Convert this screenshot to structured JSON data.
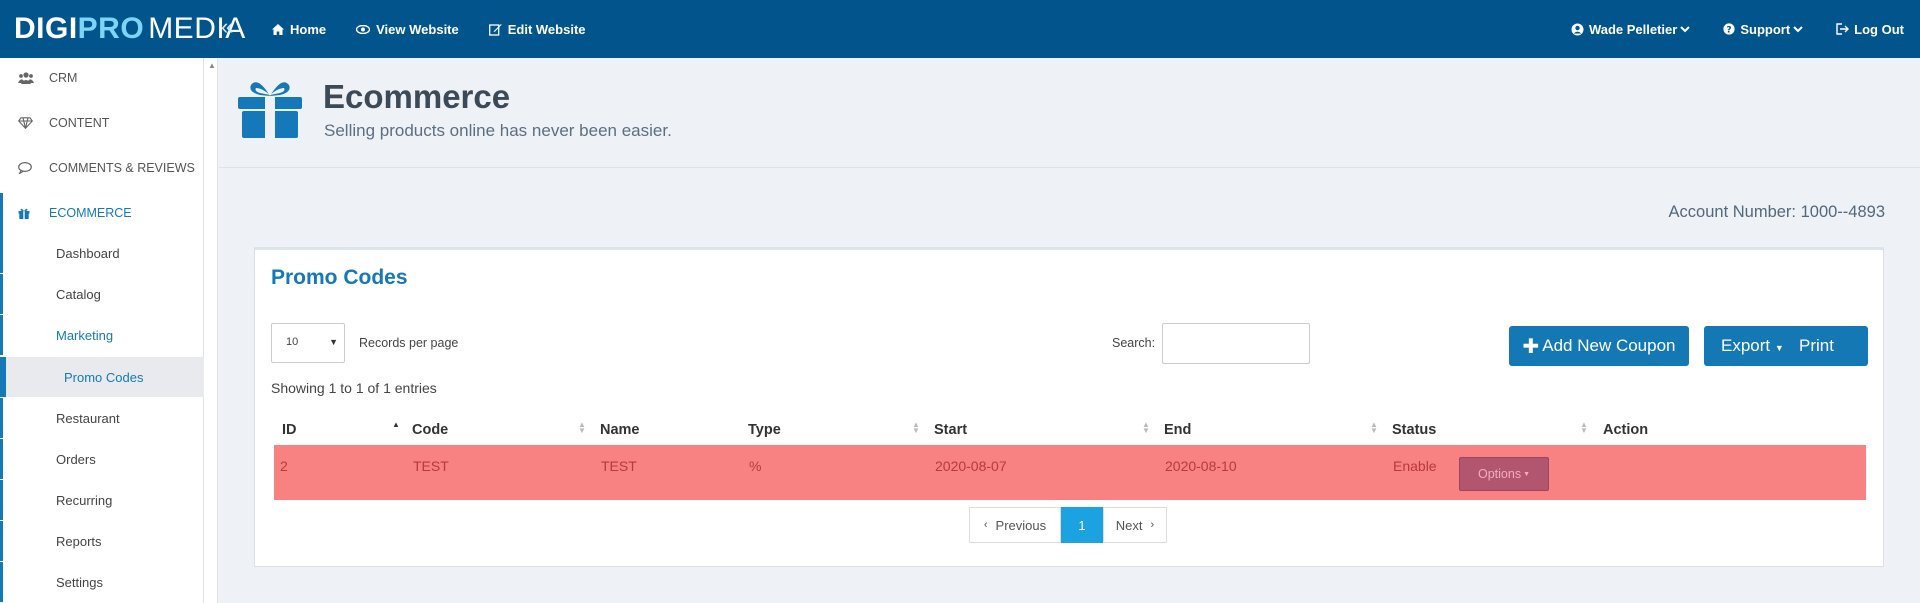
{
  "brand": {
    "part1": "DIGI",
    "part2": "PRO",
    "part3": "MEDIA"
  },
  "topnav": {
    "home": "Home",
    "view_website": "View Website",
    "edit_website": "Edit Website"
  },
  "user": {
    "name": "Wade Pelletier",
    "support": "Support",
    "logout": "Log Out"
  },
  "sidebar": {
    "items": [
      {
        "label": "CRM",
        "icon": "users-icon"
      },
      {
        "label": "CONTENT",
        "icon": "diamond-icon"
      },
      {
        "label": "COMMENTS & REVIEWS",
        "icon": "comment-icon"
      },
      {
        "label": "ECOMMERCE",
        "icon": "gift-icon"
      }
    ],
    "sub": [
      "Dashboard",
      "Catalog",
      "Marketing",
      "Promo Codes",
      "Restaurant",
      "Orders",
      "Recurring",
      "Reports",
      "Settings"
    ]
  },
  "header": {
    "title": "Ecommerce",
    "subtitle": "Selling products online has never been easier."
  },
  "account": "Account Number: 1000--4893",
  "panel": {
    "title": "Promo Codes",
    "records_value": "10",
    "records_label": "Records per page",
    "search_label": "Search:",
    "add_button": "Add New Coupon",
    "export_button": "Export",
    "print_button": "Print",
    "showing": "Showing 1 to 1 of 1 entries"
  },
  "table": {
    "columns": [
      "ID",
      "Code",
      "Name",
      "Type",
      "Start",
      "End",
      "Status",
      "Action"
    ],
    "rows": [
      {
        "id": "2",
        "code": "TEST",
        "name": "TEST",
        "type": "%",
        "start": "2020-08-07",
        "end": "2020-08-10",
        "status": "Enable",
        "action": "Options"
      }
    ]
  },
  "pagination": {
    "previous": "Previous",
    "current": "1",
    "next": "Next"
  },
  "colors": {
    "topbar": "#02558c",
    "accent": "#1578b8",
    "row_highlight": "#f88181"
  }
}
